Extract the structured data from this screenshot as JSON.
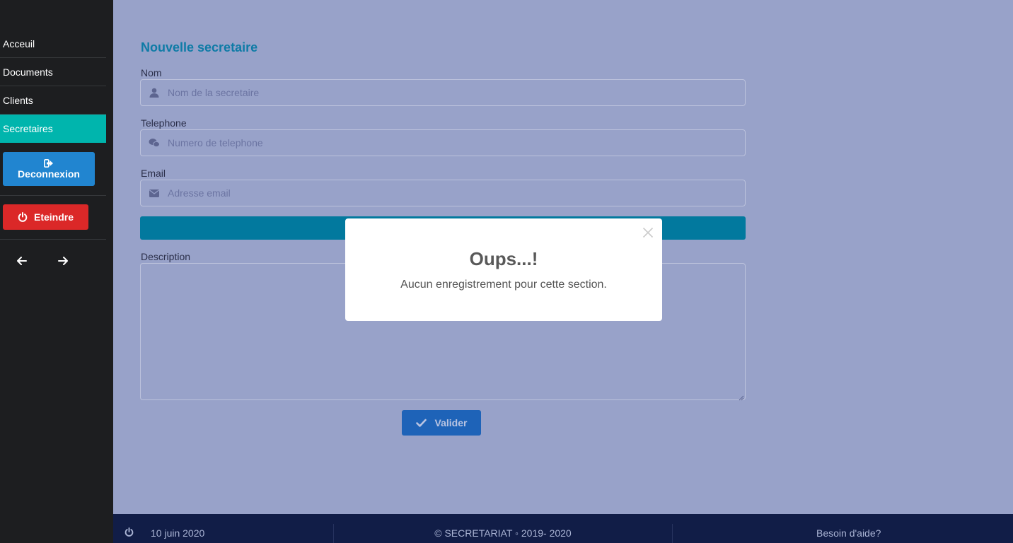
{
  "sidebar": {
    "items": [
      {
        "label": "Acceuil"
      },
      {
        "label": "Documents"
      },
      {
        "label": "Clients"
      },
      {
        "label": "Secretaires",
        "active": true
      }
    ],
    "logout_label": "Deconnexion",
    "shutdown_label": "Eteindre",
    "back_icon": "arrow-left-icon",
    "forward_icon": "arrow-right-icon"
  },
  "form": {
    "title": "Nouvelle secretaire",
    "nom": {
      "label": "Nom",
      "placeholder": "Nom de la secretaire",
      "value": "",
      "icon": "user-icon"
    },
    "telephone": {
      "label": "Telephone",
      "placeholder": "Numero de telephone",
      "value": "",
      "icon": "wechat-icon"
    },
    "email": {
      "label": "Email",
      "placeholder": "Adresse email",
      "value": "",
      "icon": "envelope-icon"
    },
    "description": {
      "label": "Description",
      "value": ""
    },
    "submit_label": "Valider"
  },
  "modal": {
    "title": "Oups...!",
    "text": "Aucun enregistrement pour cette section."
  },
  "footer": {
    "date": "10 juin 2020",
    "copyright": "© SECRETARIAT ◦ 2019- 2020",
    "help": "Besoin d'aide?"
  },
  "colors": {
    "sidebar_bg": "#1d1e20",
    "active_item": "#00b5ad",
    "logout_button": "#2185d0",
    "shutdown_button": "#db2828",
    "overlay_bg": "#98a2c9",
    "title": "#0e7ba6",
    "teal_bar": "#02799e",
    "submit_button": "#1e63b8",
    "footer_bg": "#111d47"
  }
}
